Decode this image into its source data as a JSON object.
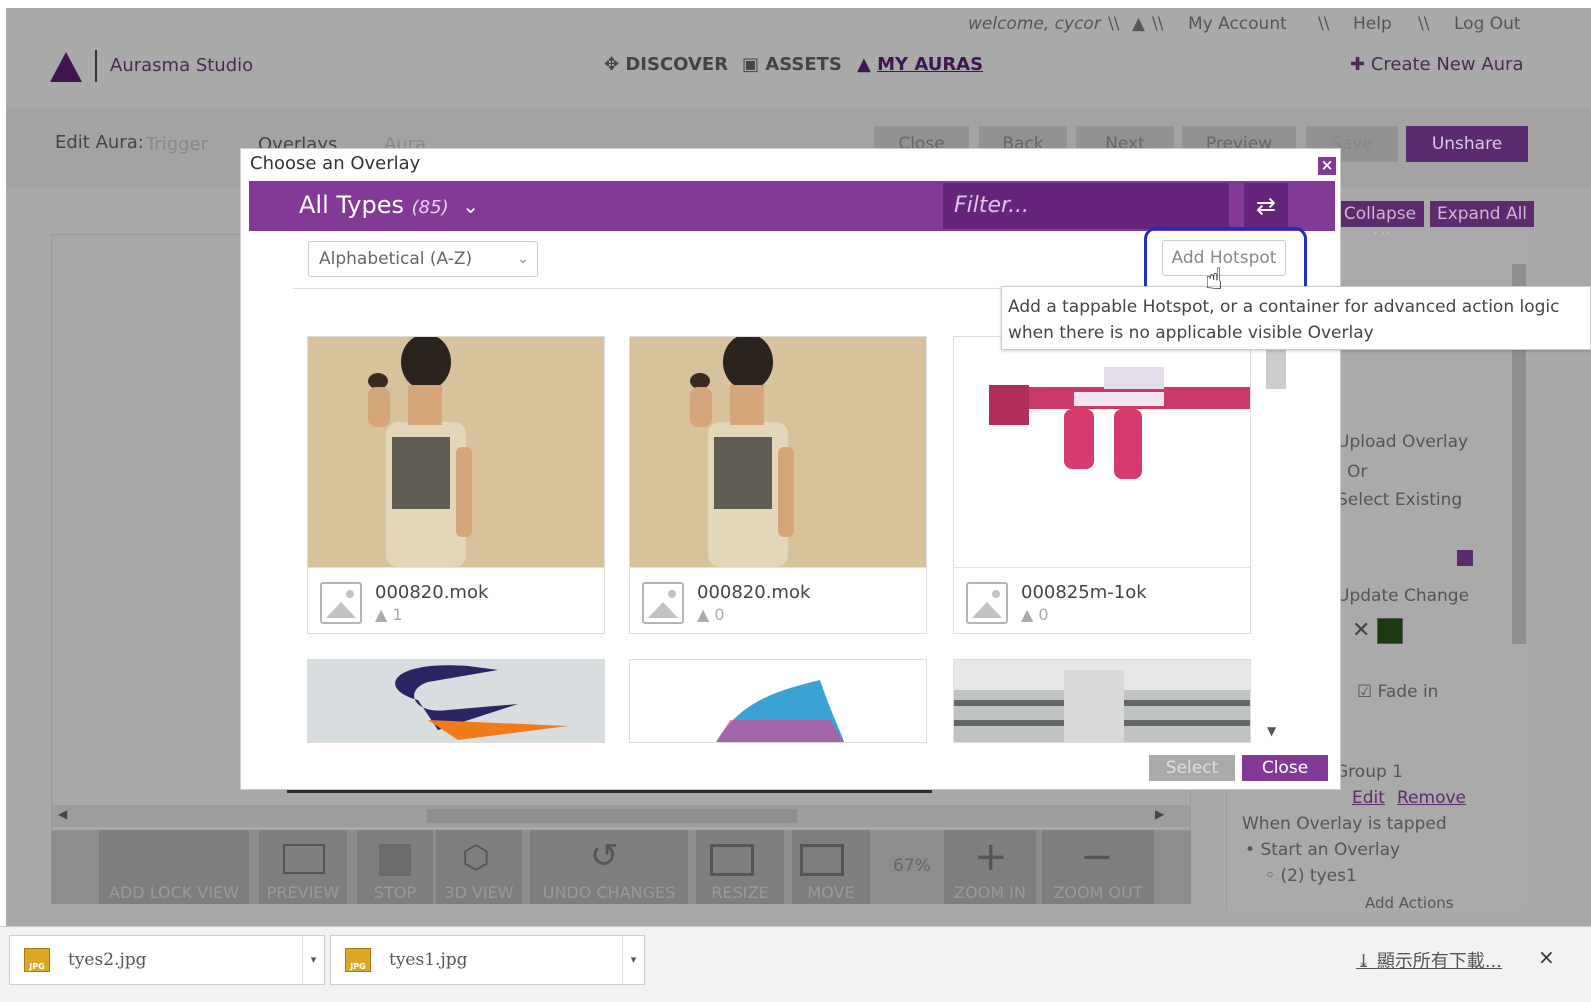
{
  "topbar": {
    "welcome": "welcome, cycor",
    "sep1": "\\\\",
    "sep2": "\\\\",
    "my_account": "My Account",
    "sep3": "\\\\",
    "help": "Help",
    "sep4": "\\\\",
    "logout": "Log Out"
  },
  "brand": {
    "name": "Aurasma Studio"
  },
  "nav": {
    "discover": "DISCOVER",
    "assets": "ASSETS",
    "my_auras": "MY AURAS",
    "create": "Create New Aura"
  },
  "editbar": {
    "label": "Edit Aura:",
    "step_trigger": "Trigger",
    "step_overlays": "Overlays",
    "step_aura": "Aura",
    "buttons": {
      "close": "Close",
      "back": "Back",
      "next": "Next",
      "preview": "Preview",
      "save": "Save",
      "unshare": "Unshare"
    }
  },
  "rightpanel": {
    "collapse_all": "Collapse All",
    "expand_all": "Expand All",
    "upload_overlay": "Upload Overlay",
    "or": "Or",
    "select_existing": "Select Existing",
    "update_change": "Update Change",
    "fade_in": "Fade in",
    "group": "Group 1",
    "edit": "Edit",
    "remove": "Remove",
    "when_tapped": "When Overlay is tapped",
    "start_overlay": "Start an Overlay",
    "tyes": "(2) tyes1",
    "add_actions": "Add Actions"
  },
  "toolbar": {
    "add_lock_view": "ADD LOCK VIEW",
    "preview": "PREVIEW",
    "stop": "STOP",
    "view_3d": "3D VIEW",
    "undo": "UNDO CHANGES",
    "resize": "RESIZE",
    "move": "MOVE",
    "zoom_level": "67%",
    "zoom_in": "ZOOM IN",
    "zoom_out": "ZOOM OUT"
  },
  "modal": {
    "title": "Choose an Overlay",
    "close_x": "×",
    "type_label": "All Types",
    "type_count": "(85)",
    "type_chevron": "⌄",
    "filter_placeholder": "Filter...",
    "refresh_icon": "⇄",
    "sort_value": "Alphabetical (A-Z)",
    "sort_chevron": "⌄",
    "add_hotspot": "Add Hotspot",
    "tooltip_line1": "Add a tappable Hotspot, or a container for advanced action logic",
    "tooltip_line2": "when there is no applicable visible Overlay",
    "select": "Select",
    "close": "Close",
    "cards": [
      {
        "name": "000820.mok",
        "count": "1"
      },
      {
        "name": "000820.mok",
        "count": "0"
      },
      {
        "name": "000825m-1ok",
        "count": "0"
      }
    ]
  },
  "downloads": {
    "items": [
      {
        "name": "tyes2.jpg"
      },
      {
        "name": "tyes1.jpg"
      }
    ],
    "show_all": "顯示所有下載...",
    "close": "×"
  },
  "colors": {
    "accent": "#833a97",
    "accent_dark": "#64257a",
    "highlight_ring": "#1a2fc7"
  }
}
